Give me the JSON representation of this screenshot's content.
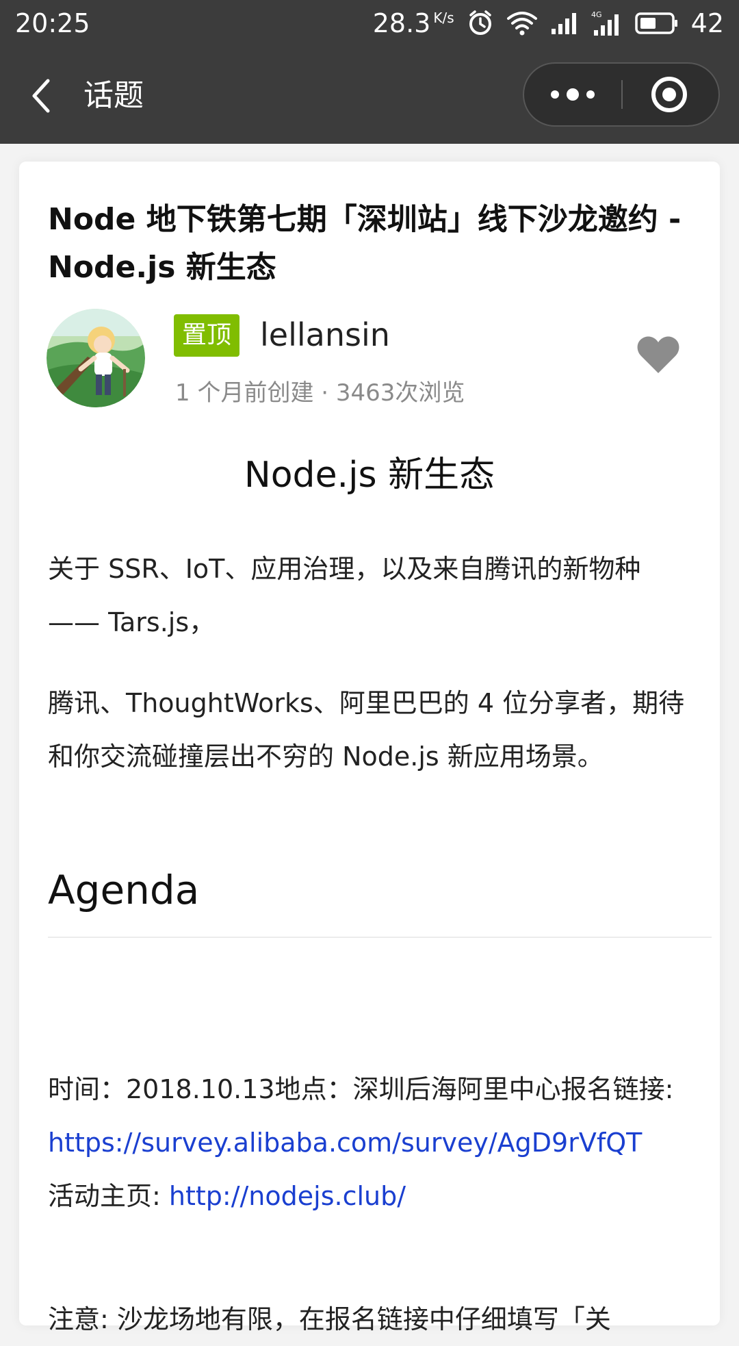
{
  "status_bar": {
    "time": "20:25",
    "speed": "28.3",
    "speed_unit": "K/s",
    "battery": "42"
  },
  "nav": {
    "title": "话题"
  },
  "topic": {
    "title": "Node 地下铁第七期「深圳站」线下沙龙邀约 - Node.js 新生态",
    "pin_label": "置顶",
    "author": "lellansin",
    "meta": "1 个月前创建 · 3463次浏览"
  },
  "content": {
    "heading": "Node.js 新生态",
    "para1": "关于 SSR、IoT、应用治理，以及来自腾讯的新物种 —— Tars.js，",
    "para2": "腾讯、ThoughtWorks、阿里巴巴的 4 位分享者，期待和你交流碰撞层出不穷的 Node.js 新应用场景。",
    "agenda": "Agenda",
    "info_text": "时间：2018.10.13地点：深圳后海阿里中心报名链接:",
    "signup_link": "https://survey.alibaba.com/survey/AgD9rVfQT",
    "homepage_label": "活动主页: ",
    "homepage_link": "http://nodejs.club/",
    "notice": "注意: 沙龙场地有限，在报名链接中仔细填写「关"
  },
  "colors": {
    "bar_bg": "#3c3c3c",
    "pin_green": "#80bd01",
    "link_blue": "#1a3fd0",
    "heart_gray": "#8c8c8c"
  }
}
